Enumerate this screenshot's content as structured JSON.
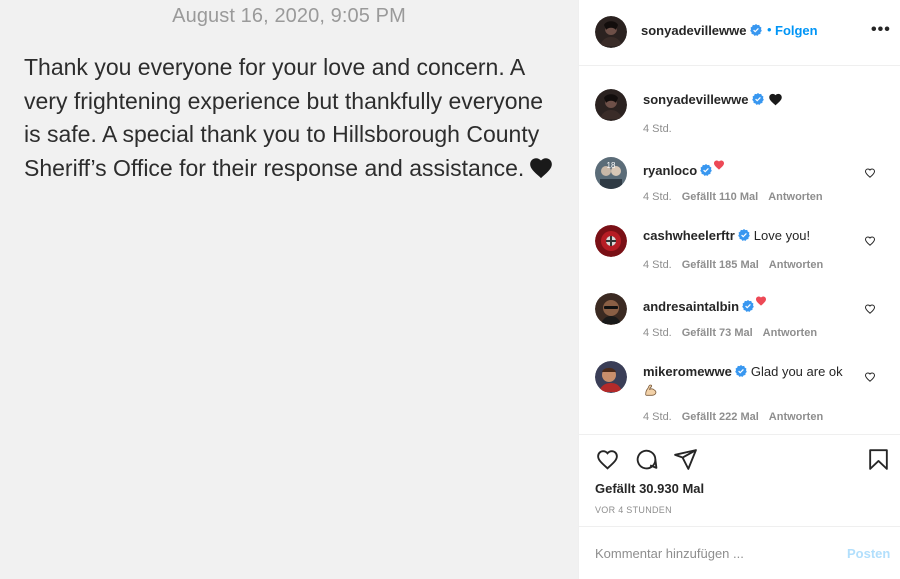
{
  "note": {
    "date": "August 16, 2020, 9:05 PM",
    "text": "Thank you everyone for your love and concern. A very frightening experience but thankfully everyone is safe. A special thank you to Hillsborough County Sheriff’s Office for their response and assistance."
  },
  "header": {
    "username": "sonyadevillewwe",
    "separator": "•",
    "follow_label": "Folgen",
    "more_label": "•••"
  },
  "caption": {
    "username": "sonyadevillewwe",
    "time": "4 Std."
  },
  "comments": [
    {
      "username": "ryanloco",
      "text": "",
      "time": "4 Std.",
      "likes": "Gefällt 110 Mal",
      "reply": "Antworten"
    },
    {
      "username": "cashwheelerftr",
      "text": "Love you!",
      "time": "4 Std.",
      "likes": "Gefällt 185 Mal",
      "reply": "Antworten"
    },
    {
      "username": "andresaintalbin",
      "text": "",
      "time": "4 Std.",
      "likes": "Gefällt 73 Mal",
      "reply": "Antworten"
    },
    {
      "username": "mikeromewwe",
      "text": "Glad you are ok",
      "time": "4 Std.",
      "likes": "Gefällt 222 Mal",
      "reply": "Antworten"
    }
  ],
  "actions": {
    "likes_total": "Gefällt 30.930 Mal",
    "ago": "VOR 4 STUNDEN"
  },
  "add_comment": {
    "placeholder": "Kommentar hinzufügen ...",
    "post_label": "Posten"
  },
  "colors": {
    "link_blue": "#0095f6",
    "verified_blue": "#3897f0",
    "post_disabled": "#b2dffc",
    "heart_red": "#ed4956"
  }
}
